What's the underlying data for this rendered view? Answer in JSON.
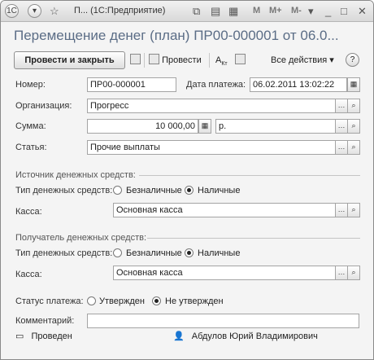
{
  "window": {
    "title": "П... (1С:Предприятие)",
    "mem_buttons": [
      "M",
      "M+",
      "M-"
    ]
  },
  "document": {
    "title": "Перемещение денег (план) ПР00-000001 от 06.0..."
  },
  "toolbar": {
    "post_close_label": "Провести и закрыть",
    "post_label": "Провести",
    "all_actions_label": "Все действия",
    "help_label": "?"
  },
  "fields": {
    "number_label": "Номер:",
    "number_value": "ПР00-000001",
    "date_label": "Дата платежа:",
    "date_value": "06.02.2011 13:02:22",
    "org_label": "Организация:",
    "org_value": "Прогресс",
    "sum_label": "Сумма:",
    "sum_value": "10 000,00",
    "currency_value": "р.",
    "article_label": "Статья:",
    "article_value": "Прочие выплаты"
  },
  "source": {
    "section_label": "Источник денежных средств:",
    "type_label": "Тип денежных средств:",
    "option_cashless": "Безналичные",
    "option_cash": "Наличные",
    "selected": "cash",
    "cashbox_label": "Касса:",
    "cashbox_value": "Основная касса"
  },
  "receiver": {
    "section_label": "Получатель денежных средств:",
    "type_label": "Тип денежных средств:",
    "option_cashless": "Безналичные",
    "option_cash": "Наличные",
    "selected": "cash",
    "cashbox_label": "Касса:",
    "cashbox_value": "Основная касса"
  },
  "payment_status": {
    "label": "Статус платежа:",
    "option_approved": "Утвержден",
    "option_not_approved": "Не утвержден",
    "selected": "not_approved"
  },
  "comment": {
    "label": "Комментарий:",
    "value": ""
  },
  "footer": {
    "status_text": "Проведен",
    "author": "Абдулов Юрий Владимирович"
  }
}
